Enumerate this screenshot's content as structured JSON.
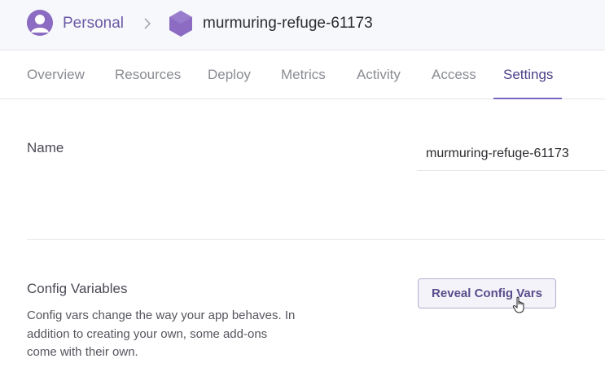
{
  "header": {
    "account_label": "Personal",
    "app_name": "murmuring-refuge-61173",
    "icons": {
      "avatar": "user-avatar-icon",
      "separator": "chevron-right-icon",
      "app": "hexagon-app-icon"
    }
  },
  "tabs": [
    {
      "label": "Overview",
      "active": false
    },
    {
      "label": "Resources",
      "active": false
    },
    {
      "label": "Deploy",
      "active": false
    },
    {
      "label": "Metrics",
      "active": false
    },
    {
      "label": "Activity",
      "active": false
    },
    {
      "label": "Access",
      "active": false
    },
    {
      "label": "Settings",
      "active": true
    }
  ],
  "settings": {
    "name_label": "Name",
    "name_value": "murmuring-refuge-61173",
    "config_label": "Config Variables",
    "config_description": "Config vars change the way your app behaves. In addition to creating your own, some add-ons come with their own.",
    "reveal_button": "Reveal Config Vars"
  },
  "colors": {
    "accent": "#7a66c2",
    "brand_purple": "#8b6cc2",
    "topbar_bg": "#f7f8fb"
  }
}
